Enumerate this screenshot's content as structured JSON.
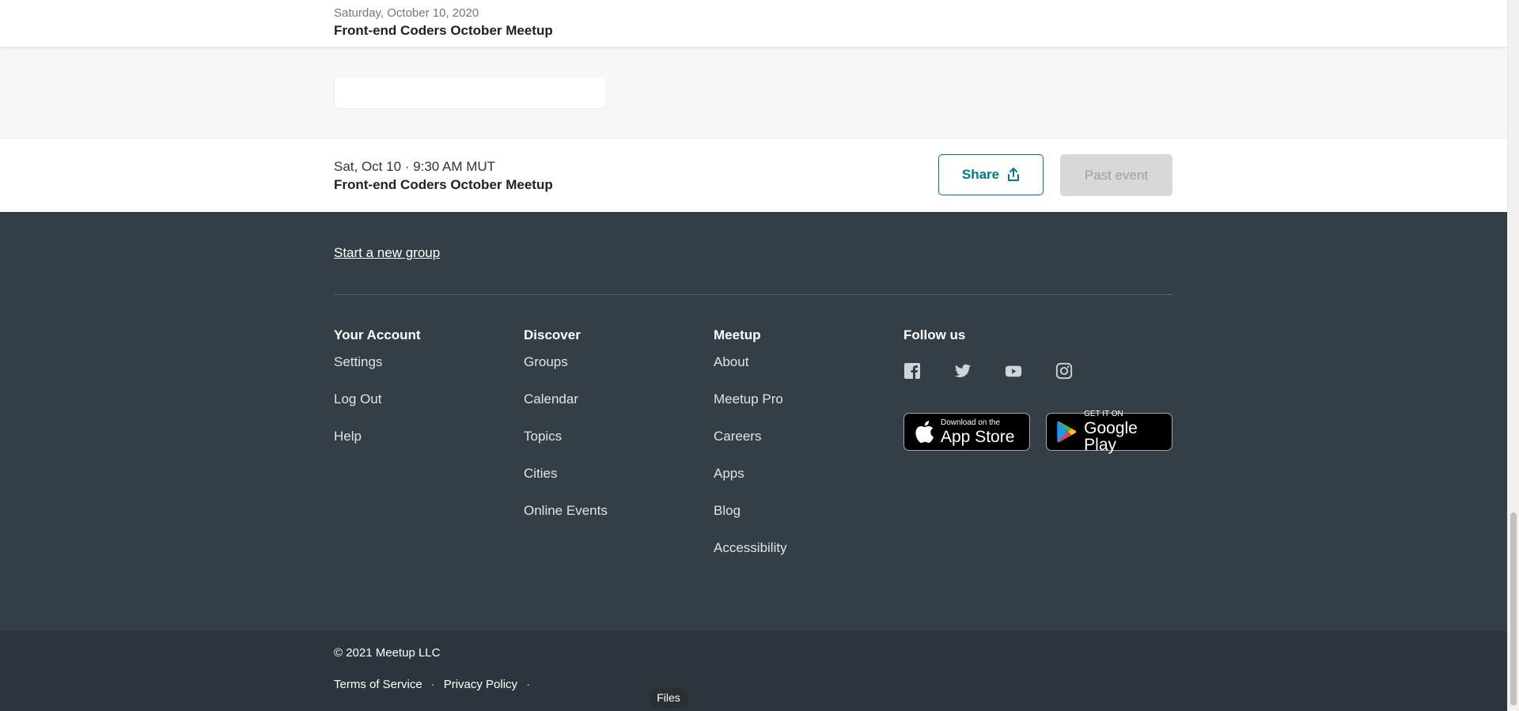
{
  "header": {
    "date": "Saturday, October 10, 2020",
    "title": "Front-end Coders October Meetup"
  },
  "action_bar": {
    "datetime": "Sat, Oct 10 · 9:30 AM MUT",
    "title": "Front-end Coders October Meetup",
    "share_label": "Share",
    "past_label": "Past event"
  },
  "footer": {
    "start_group": "Start a new group",
    "columns": [
      {
        "heading": "Your Account",
        "links": [
          "Settings",
          "Log Out",
          "Help"
        ]
      },
      {
        "heading": "Discover",
        "links": [
          "Groups",
          "Calendar",
          "Topics",
          "Cities",
          "Online Events"
        ]
      },
      {
        "heading": "Meetup",
        "links": [
          "About",
          "Meetup Pro",
          "Careers",
          "Apps",
          "Blog",
          "Accessibility"
        ]
      }
    ],
    "follow_heading": "Follow us",
    "social_icons": [
      "facebook-icon",
      "twitter-icon",
      "youtube-icon",
      "instagram-icon"
    ],
    "app_store": {
      "small": "Download on the",
      "big": "App Store"
    },
    "google_play": {
      "small": "GET IT ON",
      "big": "Google Play"
    }
  },
  "legal": {
    "copyright": "© 2021 Meetup LLC",
    "terms": "Terms of Service",
    "separator": "·",
    "privacy": "Privacy Policy"
  },
  "files_pill": "Files",
  "colors": {
    "accent": "#00798a",
    "footer_bg": "#343e47",
    "legal_bg": "#2c353d"
  }
}
